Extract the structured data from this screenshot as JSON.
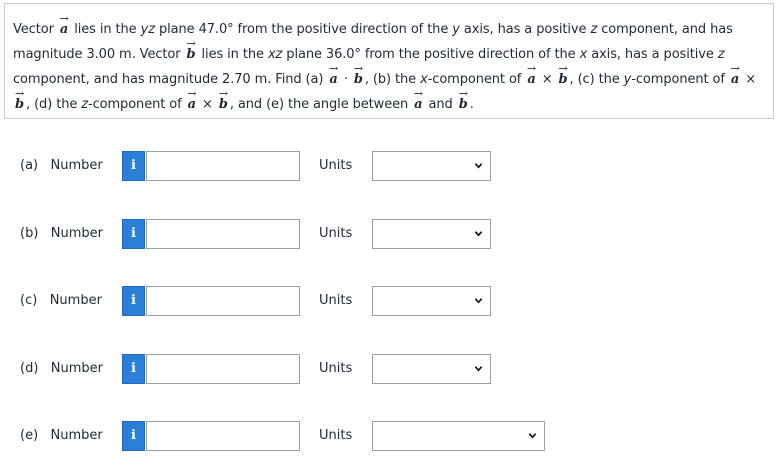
{
  "question": {
    "s1": "Vector ",
    "vec_a": "a",
    "s2": " lies in the ",
    "yz": "yz",
    "s3": " plane 47.0° from the positive direction of the ",
    "y1": "y",
    "s4": " axis, has a positive ",
    "z1": "z",
    "s5": " component, and has magnitude 3.00 m. Vector ",
    "vec_b": "b",
    "s6": " lies in the ",
    "xz": "xz",
    "s7": " plane 36.0° from the positive direction of the ",
    "x1": "x",
    "s8": " axis, has a positive ",
    "z2": "z",
    "s9": " component, and has magnitude 2.70 m. Find (a) ",
    "dot": " · ",
    "s10": ", (b) the ",
    "x2": "x",
    "s11": "-component of ",
    "cross": " × ",
    "s12": ", (c) the ",
    "y2": "y",
    "s13": "-component of ",
    "s14": ", (d) the ",
    "z3": "z",
    "s15": "-component of ",
    "s16": ", and (e) the angle between ",
    "and": " and ",
    "end": "."
  },
  "rows": [
    {
      "label": "(a)   Number",
      "info": "i",
      "number_value": "",
      "units_label": "Units",
      "units_value": ""
    },
    {
      "label": "(b)   Number",
      "info": "i",
      "number_value": "",
      "units_label": "Units",
      "units_value": ""
    },
    {
      "label": "(c)   Number",
      "info": "i",
      "number_value": "",
      "units_label": "Units",
      "units_value": ""
    },
    {
      "label": "(d)   Number",
      "info": "i",
      "number_value": "",
      "units_label": "Units",
      "units_value": ""
    },
    {
      "label": "(e)   Number",
      "info": "i",
      "number_value": "",
      "units_label": "Units",
      "units_value": ""
    }
  ],
  "colors": {
    "info_button": "#2c7fd6",
    "border": "#9aa0a6",
    "text": "#1f2a38"
  },
  "icons": {
    "info": "info-icon",
    "dropdown": "chevron-down-icon"
  }
}
